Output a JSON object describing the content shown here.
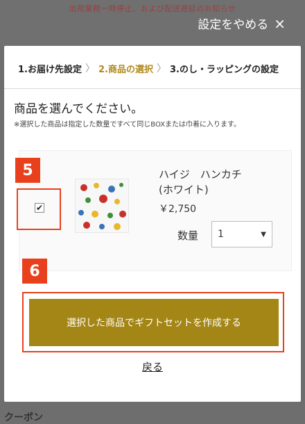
{
  "background_notice": "出荷業務一時停止、および配送遅延のお知らせ",
  "close_bar": {
    "label": "設定をやめる",
    "close_glyph": "×"
  },
  "steps": [
    {
      "label": "1.お届け先設定",
      "active": false
    },
    {
      "label": "2.商品の選択",
      "active": true
    },
    {
      "label": "3.のし・ラッピングの設定",
      "active": false
    }
  ],
  "step_separator": "〉",
  "heading": "商品を選んでください。",
  "note": "※選択した商品は指定した数量ですべて同じBOXまたは巾着に入ります。",
  "badges": {
    "five": "5",
    "six": "6"
  },
  "product": {
    "name_line1": "ハイジ　ハンカチ",
    "name_line2": "(ホワイト)",
    "price": "￥2,750",
    "checked": true,
    "check_glyph": "✔",
    "quantity_label": "数量",
    "quantity_value": "1",
    "dropdown_glyph": "▼"
  },
  "action_button": "選択した商品でギフトセットを作成する",
  "back_link": "戻る",
  "bottom_peek": "クーポン",
  "colors": {
    "accent_gold": "#a48616",
    "active_step": "#b0891a",
    "highlight_red": "#e8401c",
    "overlay": "#707070"
  }
}
